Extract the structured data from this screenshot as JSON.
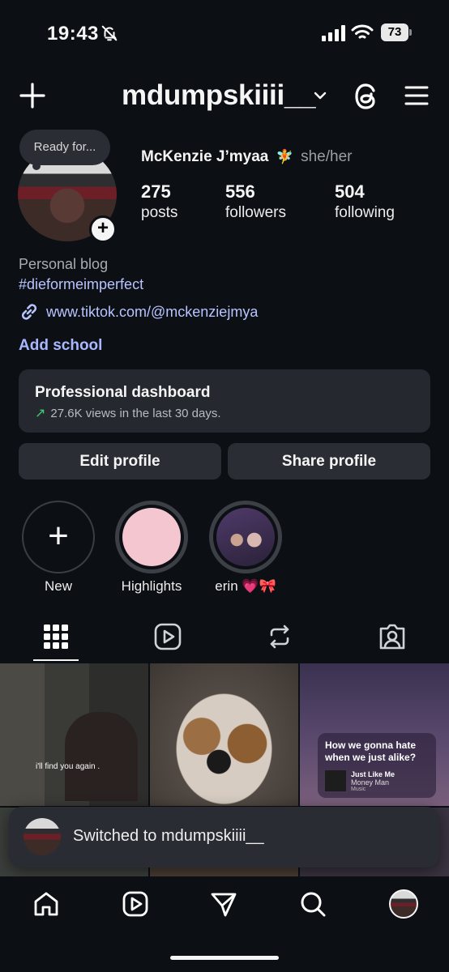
{
  "status_bar": {
    "time": "19:43",
    "battery": "73"
  },
  "header": {
    "username": "mdumpskiiii__"
  },
  "note": {
    "text": "Ready for..."
  },
  "profile": {
    "name": "McKenzie J’myaa",
    "emoji": "🧚",
    "pronouns": "she/her",
    "stats": [
      {
        "value": "275",
        "label": "posts"
      },
      {
        "value": "556",
        "label": "followers"
      },
      {
        "value": "504",
        "label": "following"
      }
    ],
    "category": "Personal blog",
    "hashtag": "#dieformeimperfect",
    "link": "www.tiktok.com/@mckenziejmya",
    "add_school": "Add school"
  },
  "dashboard": {
    "title": "Professional dashboard",
    "subtitle": "27.6K views in the last 30 days."
  },
  "buttons": {
    "edit": "Edit profile",
    "share": "Share profile"
  },
  "highlights": [
    {
      "label": "New"
    },
    {
      "label": "Highlights"
    },
    {
      "label": "erin 💗🎀"
    }
  ],
  "tabs": [
    "grid-icon",
    "reels-icon",
    "reposts-icon",
    "tagged-icon"
  ],
  "posts": {
    "post1_caption": "i'll find you again .",
    "post3_question": "How we gonna hate when we just alike?",
    "post3_song": "Just Like Me",
    "post3_artist": "Money Man",
    "post3_service": "Music"
  },
  "toast": {
    "text": "Switched to mdumpskiiii__"
  },
  "colors": {
    "background": "#0c0f14",
    "link": "#b8c4ff",
    "accent": "#a9b7ff",
    "card": "#25282e",
    "trend": "#3ecf72"
  }
}
